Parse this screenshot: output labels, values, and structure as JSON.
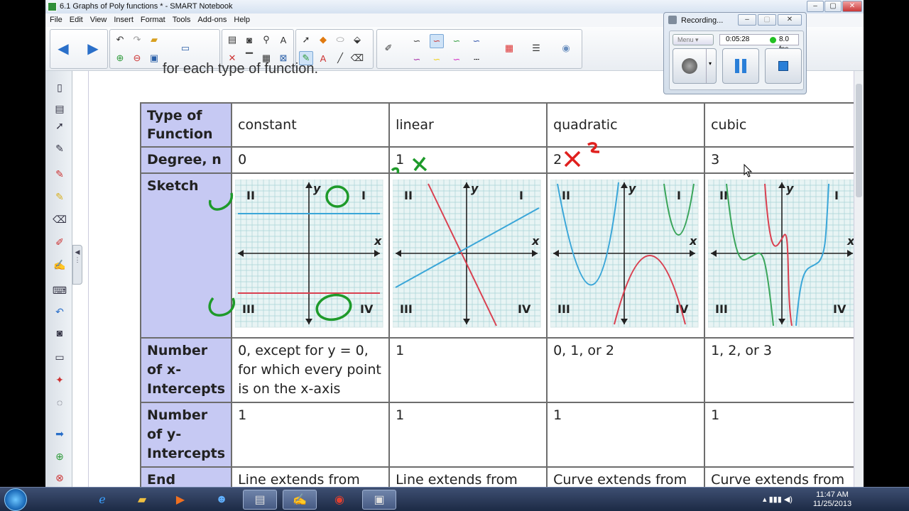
{
  "window": {
    "title": "6.1 Graphs of Poly functions * - SMART Notebook",
    "minimize": "–",
    "maximize": "▢",
    "close": "✕"
  },
  "menu": [
    "File",
    "Edit",
    "View",
    "Insert",
    "Format",
    "Tools",
    "Add-ons",
    "Help"
  ],
  "recorder": {
    "title": "Recording...",
    "menu_label": "Menu",
    "time": "0:05:28",
    "fps": "8.0 fps"
  },
  "page": {
    "intro": "for each type of function.",
    "col_header_label": "Type of Function",
    "columns": [
      "constant",
      "linear",
      "quadratic",
      "cubic"
    ],
    "rows": {
      "degree": {
        "label": "Degree, n",
        "values": [
          "0",
          "1",
          "2",
          "3"
        ]
      },
      "sketch": {
        "label": "Sketch"
      },
      "x_intercepts": {
        "label": "Number of x-Intercepts",
        "values": [
          "0, except for y = 0, for which every point is on the x-axis",
          "1",
          "0, 1, or 2",
          "1, 2, or 3"
        ]
      },
      "y_intercepts": {
        "label": "Number of y-Intercepts",
        "values": [
          "1",
          "1",
          "1",
          "1"
        ]
      },
      "end_behaviour": {
        "label": "End Behaviour",
        "values": [
          "Line extends from quadrant II to",
          "Line extends from quadrant III to",
          "Curve extends from quadrant II",
          "Curve extends from quadrant III"
        ]
      }
    },
    "quadrants": {
      "q1": "I",
      "q2": "II",
      "q3": "III",
      "q4": "IV"
    },
    "axis_x": "x",
    "axis_y": "y"
  },
  "taskbar": {
    "time": "11:47 AM",
    "date": "11/25/2013"
  },
  "colors": {
    "header_cell": "#c6c9f3",
    "curve_blue": "#3aa6d8",
    "curve_red": "#d94050",
    "curve_green": "#3aa55a",
    "ink_green": "#1e9a2a",
    "ink_red": "#e0201e"
  }
}
